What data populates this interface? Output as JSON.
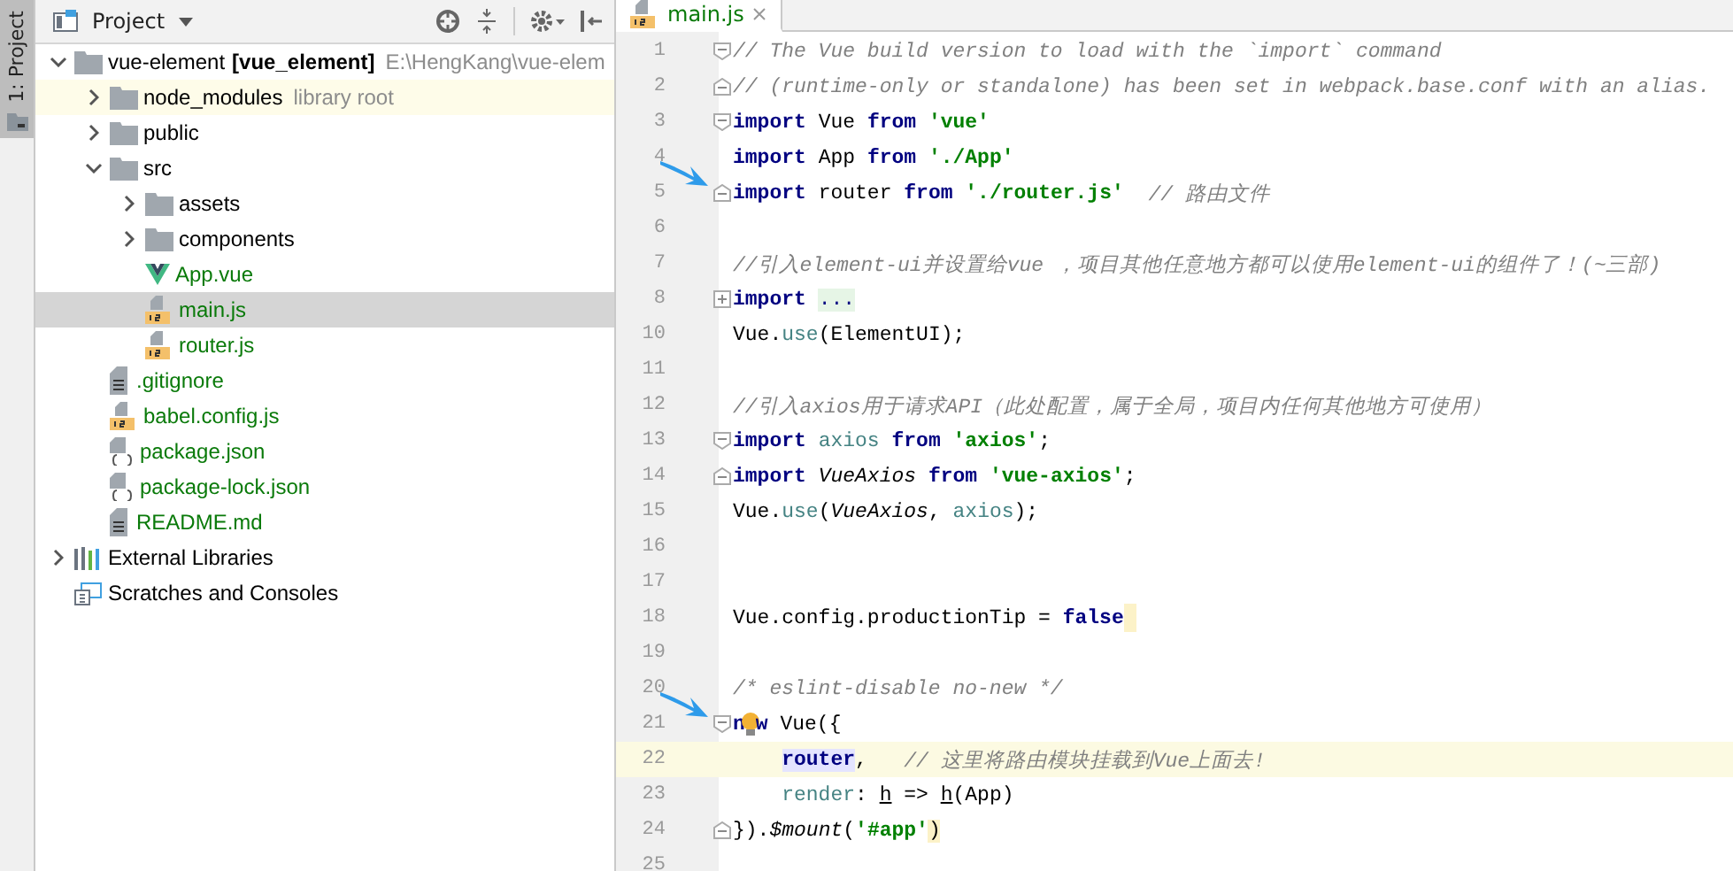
{
  "tool_strip": {
    "label": "1: Project",
    "selected": true
  },
  "project_panel": {
    "title": "Project",
    "tree": [
      {
        "kind": "module",
        "name": "vue-element",
        "bold_suffix": "[vue_element]",
        "hint": "E:\\HengKang\\vue-elem",
        "expanded": true,
        "selected": false,
        "highlighted": false,
        "children": [
          {
            "kind": "folder",
            "name": "node_modules",
            "hint": "library root",
            "expanded": false,
            "selected": false,
            "highlighted": true
          },
          {
            "kind": "folder",
            "name": "public",
            "expanded": false,
            "selected": false,
            "highlighted": false
          },
          {
            "kind": "folder",
            "name": "src",
            "expanded": true,
            "selected": false,
            "highlighted": false,
            "children": [
              {
                "kind": "folder",
                "name": "assets",
                "expanded": false,
                "selected": false,
                "highlighted": false
              },
              {
                "kind": "folder",
                "name": "components",
                "expanded": false,
                "selected": false,
                "highlighted": false
              },
              {
                "kind": "vue",
                "name": "App.vue",
                "selected": false,
                "highlighted": false
              },
              {
                "kind": "js",
                "name": "main.js",
                "selected": true,
                "highlighted": false
              },
              {
                "kind": "js",
                "name": "router.js",
                "selected": false,
                "highlighted": false
              }
            ]
          },
          {
            "kind": "text",
            "name": ".gitignore",
            "selected": false,
            "highlighted": false
          },
          {
            "kind": "js",
            "name": "babel.config.js",
            "selected": false,
            "highlighted": false
          },
          {
            "kind": "json",
            "name": "package.json",
            "selected": false,
            "highlighted": false
          },
          {
            "kind": "json",
            "name": "package-lock.json",
            "selected": false,
            "highlighted": false
          },
          {
            "kind": "text",
            "name": "README.md",
            "selected": false,
            "highlighted": false
          }
        ]
      },
      {
        "kind": "libs",
        "name": "External Libraries",
        "expanded": false,
        "selected": false,
        "highlighted": false
      },
      {
        "kind": "scratches",
        "name": "Scratches and Consoles",
        "selected": false,
        "highlighted": false
      }
    ]
  },
  "editor": {
    "tabs": [
      {
        "label": "main.js",
        "selected": true
      }
    ],
    "lines": [
      {
        "number": "1",
        "fold_marker": {
          "kind": "start"
        },
        "current": false,
        "marked": false,
        "tokens": [
          {
            "kind": "comment",
            "text": "// The Vue build version to load with the `import` command"
          }
        ]
      },
      {
        "number": "2",
        "fold_marker": {
          "kind": "end"
        },
        "current": false,
        "marked": false,
        "tokens": [
          {
            "kind": "comment",
            "text": "// (runtime-only or standalone) has been set in webpack.base.conf with an alias."
          }
        ]
      },
      {
        "number": "3",
        "fold_marker": {
          "kind": "start"
        },
        "current": false,
        "marked": false,
        "tokens": [
          {
            "kind": "kw",
            "text": "import"
          },
          {
            "kind": "plain",
            "text": " Vue "
          },
          {
            "kind": "kw",
            "text": "from "
          },
          {
            "kind": "str",
            "text": "'vue'"
          }
        ]
      },
      {
        "number": "4",
        "current": false,
        "marked": false,
        "tokens": [
          {
            "kind": "kw",
            "text": "import"
          },
          {
            "kind": "plain",
            "text": " App "
          },
          {
            "kind": "kw",
            "text": "from "
          },
          {
            "kind": "str",
            "text": "'./App'"
          }
        ]
      },
      {
        "number": "5",
        "fold_marker": {
          "kind": "end"
        },
        "current": false,
        "marked": true,
        "tokens": [
          {
            "kind": "kw",
            "text": "import"
          },
          {
            "kind": "plain",
            "text": " router "
          },
          {
            "kind": "kw",
            "text": "from "
          },
          {
            "kind": "str",
            "text": "'./router.js'  "
          },
          {
            "kind": "comment",
            "text": "// 路由文件"
          }
        ]
      },
      {
        "number": "6",
        "current": false,
        "marked": false
      },
      {
        "number": "7",
        "current": false,
        "marked": false,
        "tokens": [
          {
            "kind": "comment",
            "text": "//引入element-ui并设置给vue ，项目其他任意地方都可以使用element-ui的组件了！(~三部)"
          }
        ]
      },
      {
        "number": "8",
        "fold_marker": {
          "kind": "collapsed"
        },
        "current": false,
        "marked": false,
        "tokens": [
          {
            "kind": "kw",
            "text": "import "
          },
          {
            "kind": "folded",
            "text": "..."
          }
        ]
      },
      {
        "number": "10",
        "current": false,
        "marked": false,
        "tokens": [
          {
            "kind": "plain",
            "text": "Vue."
          },
          {
            "kind": "member",
            "text": "use"
          },
          {
            "kind": "plain",
            "text": "(ElementUI);"
          }
        ]
      },
      {
        "number": "11",
        "current": false,
        "marked": false
      },
      {
        "number": "12",
        "current": false,
        "marked": false,
        "tokens": [
          {
            "kind": "comment",
            "text": "//引入axios用于请求API（此处配置，属于全局，项目内任何其他地方可使用）"
          }
        ]
      },
      {
        "number": "13",
        "fold_marker": {
          "kind": "start"
        },
        "current": false,
        "marked": false,
        "tokens": [
          {
            "kind": "kw",
            "text": "import "
          },
          {
            "kind": "member",
            "text": "axios "
          },
          {
            "kind": "kw",
            "text": "from "
          },
          {
            "kind": "str",
            "text": "'axios'"
          },
          {
            "kind": "plain",
            "text": ";"
          }
        ]
      },
      {
        "number": "14",
        "fold_marker": {
          "kind": "end"
        },
        "current": false,
        "marked": false,
        "tokens": [
          {
            "kind": "kw",
            "text": "import "
          },
          {
            "kind": "ital",
            "text": "VueAxios "
          },
          {
            "kind": "kw",
            "text": "from "
          },
          {
            "kind": "str",
            "text": "'vue-axios'"
          },
          {
            "kind": "plain",
            "text": ";"
          }
        ]
      },
      {
        "number": "15",
        "current": false,
        "marked": false,
        "tokens": [
          {
            "kind": "plain",
            "text": "Vue."
          },
          {
            "kind": "member",
            "text": "use"
          },
          {
            "kind": "plain",
            "text": "("
          },
          {
            "kind": "ital",
            "text": "VueAxios"
          },
          {
            "kind": "plain",
            "text": ", "
          },
          {
            "kind": "member",
            "text": "axios"
          },
          {
            "kind": "plain",
            "text": ");"
          }
        ]
      },
      {
        "number": "16",
        "current": false,
        "marked": false
      },
      {
        "number": "17",
        "current": false,
        "marked": false
      },
      {
        "number": "18",
        "current": false,
        "marked": false,
        "tokens": [
          {
            "kind": "plain",
            "text": "Vue.config.productionTip = "
          },
          {
            "kind": "kw",
            "text": "false"
          },
          {
            "kind": "caret"
          }
        ]
      },
      {
        "number": "19",
        "current": false,
        "marked": false
      },
      {
        "number": "20",
        "current": false,
        "marked": false,
        "tokens": [
          {
            "kind": "comment",
            "text": "/* eslint-disable no-new */"
          }
        ]
      },
      {
        "number": "21",
        "fold_marker": {
          "kind": "start"
        },
        "current": false,
        "marked": true,
        "tokens": [
          {
            "kind": "kw",
            "text": "n"
          },
          {
            "kind": "bulb"
          },
          {
            "kind": "kw",
            "text": "w"
          },
          {
            "kind": "plain",
            "text": " Vue({"
          }
        ]
      },
      {
        "number": "22",
        "current": true,
        "marked": false,
        "indented": true,
        "tokens": [
          {
            "kind": "hl",
            "text": "router"
          },
          {
            "kind": "plain",
            "text": ",   "
          },
          {
            "kind": "comment",
            "text": "// 这里将路由模块挂载到Vue上面去!"
          }
        ]
      },
      {
        "number": "23",
        "current": false,
        "marked": false,
        "indented": true,
        "tokens": [
          {
            "kind": "member",
            "text": "render"
          },
          {
            "kind": "plain",
            "text": ": "
          },
          {
            "kind": "param",
            "text": "h"
          },
          {
            "kind": "plain",
            "text": " => "
          },
          {
            "kind": "param",
            "text": "h"
          },
          {
            "kind": "plain",
            "text": "(App)"
          }
        ]
      },
      {
        "number": "24",
        "fold_marker": {
          "kind": "end"
        },
        "current": false,
        "marked": false,
        "tokens": [
          {
            "kind": "plain",
            "text": "})."
          },
          {
            "kind": "ital",
            "text": "$mount"
          },
          {
            "kind": "plain",
            "text": "("
          },
          {
            "kind": "str",
            "text": "'#app'"
          },
          {
            "kind": "brace",
            "text": ")"
          }
        ]
      },
      {
        "number": "25",
        "current": false,
        "marked": false
      }
    ]
  }
}
